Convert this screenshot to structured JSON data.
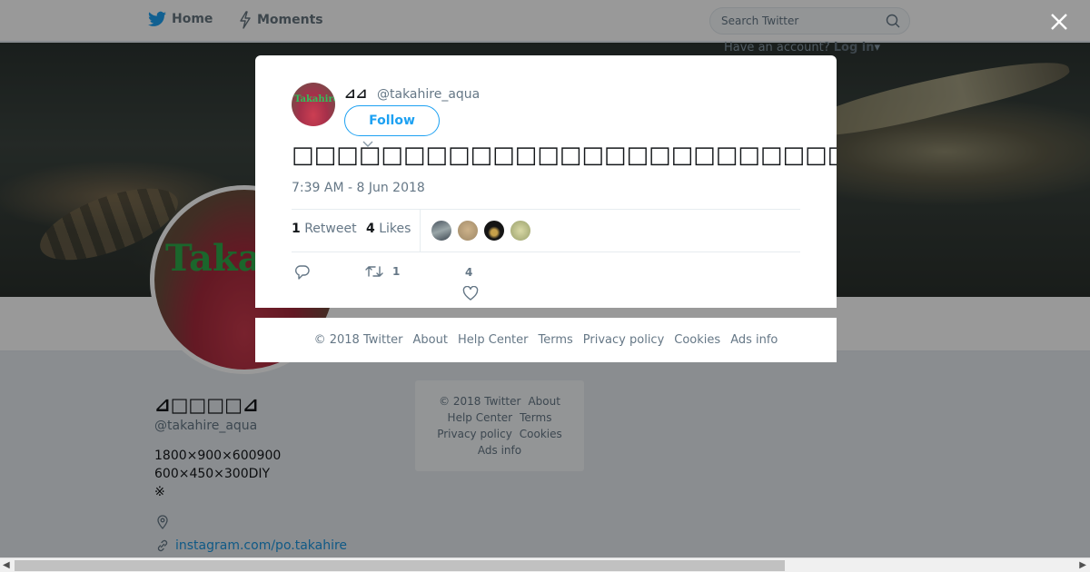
{
  "nav": {
    "home_label": "Home",
    "moments_label": "Moments",
    "search_placeholder": "Search Twitter",
    "account_prompt": "Have an account?",
    "login_label": "Log in"
  },
  "profile": {
    "avatar_text": "Taka",
    "name": "⊿□□□□⊿",
    "handle": "@takahire_aqua",
    "bio_lines": [
      "1800×900×600900",
      "600×450×300DIY",
      "※"
    ],
    "link": "instagram.com/po.takahire"
  },
  "side_footer": {
    "copyright": "© 2018 Twitter",
    "about": "About",
    "help": "Help Center",
    "terms": "Terms",
    "privacy": "Privacy policy",
    "cookies": "Cookies",
    "ads": "Ads info"
  },
  "tweet": {
    "avatar_text": "Takahire",
    "display_name": "⊿⊿",
    "handle": "@takahire_aqua",
    "follow_label": "Follow",
    "text": "□□□□□□□□□□□□□□□□□□□□□□□□□□□□□□□□□(□□)□□□□□□□□□□□□□□□□□□□□□□□□□□□",
    "timestamp": "7:39 AM - 8 Jun 2018",
    "retweet_count": "1",
    "retweet_label": "Retweet",
    "like_count": "4",
    "like_label": "Likes",
    "action_retweet_count": "1",
    "action_like_count": "4"
  },
  "modal_footer": {
    "copyright": "© 2018 Twitter",
    "about": "About",
    "help": "Help Center",
    "terms": "Terms",
    "privacy": "Privacy policy",
    "cookies": "Cookies",
    "ads": "Ads info"
  },
  "colors": {
    "accent": "#1da1f2",
    "link": "#1b95e0",
    "muted": "#657786"
  }
}
